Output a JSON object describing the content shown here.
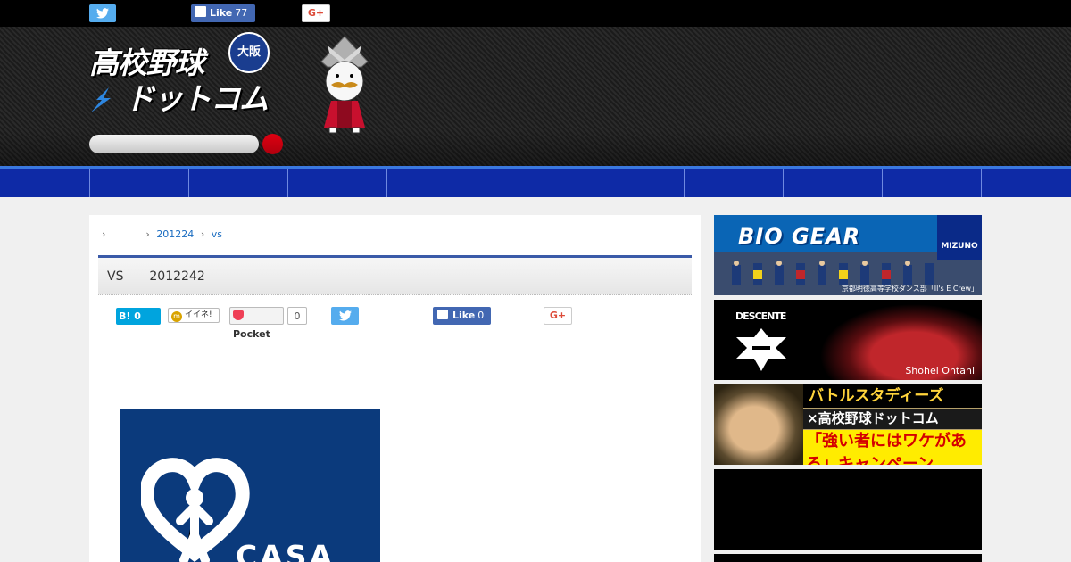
{
  "topbar": {
    "twitter_icon": "twitter-bird-icon",
    "fb_like_label": "Like",
    "fb_like_count": "77",
    "gplus_label": "G+"
  },
  "header": {
    "logo_line1": "高校野球",
    "logo_line2": "ドットコム",
    "logo_badge": "大阪",
    "search_placeholder": ""
  },
  "nav": {
    "items": [
      "",
      "",
      "",
      "",
      "",
      "",
      "",
      "",
      ""
    ]
  },
  "breadcrumb": {
    "items": [
      "",
      "201224",
      "vs"
    ]
  },
  "article": {
    "title_vs": "VS",
    "title_date": "2012242"
  },
  "share": {
    "hatena_label": "B!",
    "hatena_count": "0",
    "mixi_label": "イイネ!",
    "pocket_label": "Pocket",
    "pocket_count": "0",
    "fb_like_label": "Like",
    "fb_like_count": "0",
    "gplus_label": "G+"
  },
  "ad": {
    "brand": "CASA",
    "registered": "®"
  },
  "sidebar": {
    "b1_title": "BIO GEAR",
    "b1_brand": "MIZUNO",
    "b1_caption": "京都明徳高等学校ダンス部「Il's E Crew」",
    "b2_brand": "DESCENTE",
    "b2_name": "Shohei Ohtani",
    "b3_top": "バトルスタディーズ",
    "b3_mid": "×高校野球ドットコム",
    "b3_bottom": "「強い者にはワケがある」キャンペーン"
  },
  "colors": {
    "nav_bg": "#0e2aa6",
    "accent_red": "#e60012",
    "twitter": "#55acee",
    "facebook": "#4267b2",
    "hatena": "#00a4de"
  }
}
